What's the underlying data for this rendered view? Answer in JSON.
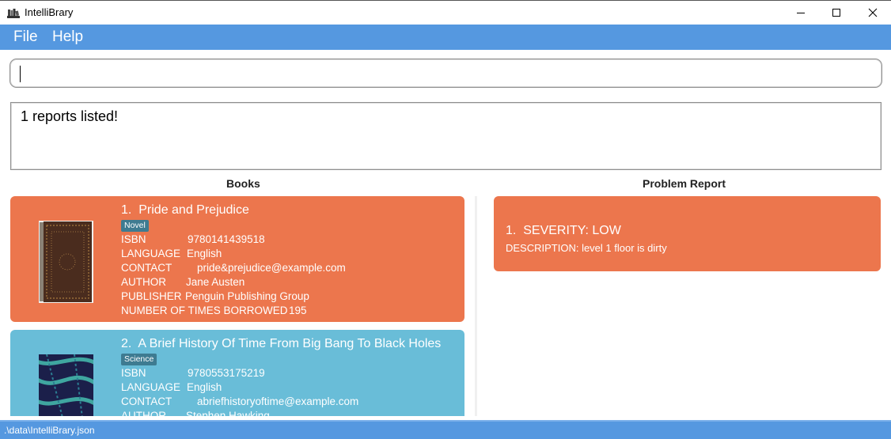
{
  "window": {
    "title": "IntelliBrary",
    "icon": "books-icon"
  },
  "menu": {
    "file": "File",
    "help": "Help"
  },
  "command": {
    "value": "",
    "placeholder": ""
  },
  "result": {
    "text": "1 reports listed!"
  },
  "books_panel": {
    "title": "Books",
    "items": [
      {
        "index": "1.",
        "title": "Pride and Prejudice",
        "tag": "Novel",
        "isbn_label": "ISBN",
        "isbn": "9780141439518",
        "language_label": "LANGUAGE",
        "language": "English",
        "contact_label": "CONTACT",
        "contact": "pride&prejudice@example.com",
        "author_label": "AUTHOR",
        "author": "Jane Austen",
        "publisher_label": "PUBLISHER",
        "publisher": "Penguin Publishing Group",
        "borrowed_label": "NUMBER OF TIMES BORROWED",
        "borrowed": "195",
        "color": "#ec764d"
      },
      {
        "index": "2.",
        "title": "A Brief History Of Time From Big Bang To Black Holes",
        "tag": "Science",
        "isbn_label": "ISBN",
        "isbn": "9780553175219",
        "language_label": "LANGUAGE",
        "language": "English",
        "contact_label": "CONTACT",
        "contact": "abriefhistoryoftime@example.com",
        "author_label": "AUTHOR",
        "author": "Stephen Hawking",
        "color": "#69bdd8"
      }
    ]
  },
  "report_panel": {
    "title": "Problem Report",
    "items": [
      {
        "index": "1.",
        "severity": "SEVERITY: LOW",
        "description": "DESCRIPTION: level 1 floor is dirty",
        "color": "#ec764d"
      }
    ]
  },
  "status": {
    "path": ".\\data\\IntelliBrary.json"
  },
  "colors": {
    "accent": "#5598e0",
    "card_orange": "#ec764d",
    "card_blue": "#69bdd8",
    "tag": "#3e7b91"
  }
}
